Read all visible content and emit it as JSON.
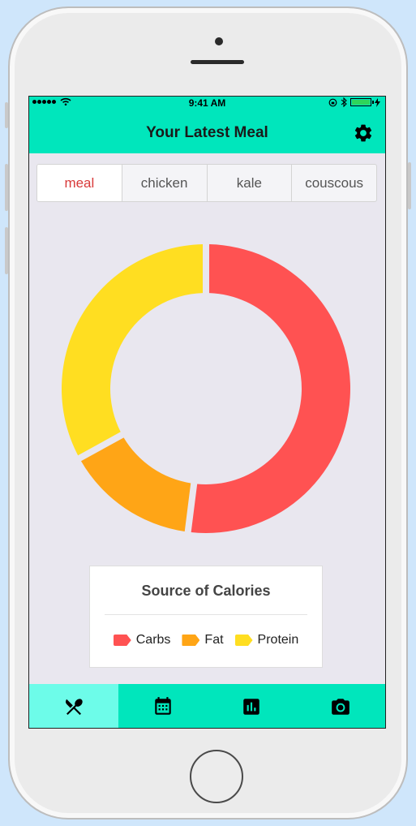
{
  "status_bar": {
    "time": "9:41 AM"
  },
  "header": {
    "title": "Your Latest Meal",
    "settings_icon": "gear-icon"
  },
  "tabs": [
    {
      "label": "meal",
      "active": true
    },
    {
      "label": "chicken",
      "active": false
    },
    {
      "label": "kale",
      "active": false
    },
    {
      "label": "couscous",
      "active": false
    }
  ],
  "colors": {
    "header": "#00e6bc",
    "active_tab_text": "#d83a3a",
    "active_nav": "#6dfce9"
  },
  "legend": {
    "title": "Source of Calories",
    "items": [
      {
        "label": "Carbs",
        "color": "#ff5252"
      },
      {
        "label": "Fat",
        "color": "#ffa516"
      },
      {
        "label": "Protein",
        "color": "#ffde21"
      }
    ]
  },
  "chart_data": {
    "type": "pie",
    "donut": true,
    "categories": [
      "Carbs",
      "Fat",
      "Protein"
    ],
    "values": [
      52,
      15,
      33
    ],
    "colors": [
      "#ff5252",
      "#ffa516",
      "#ffde21"
    ],
    "title": "Source of Calories"
  },
  "bottom_nav": [
    {
      "icon": "fork-knife-icon",
      "active": true
    },
    {
      "icon": "calendar-icon",
      "active": false
    },
    {
      "icon": "bar-chart-icon",
      "active": false
    },
    {
      "icon": "camera-icon",
      "active": false
    }
  ]
}
